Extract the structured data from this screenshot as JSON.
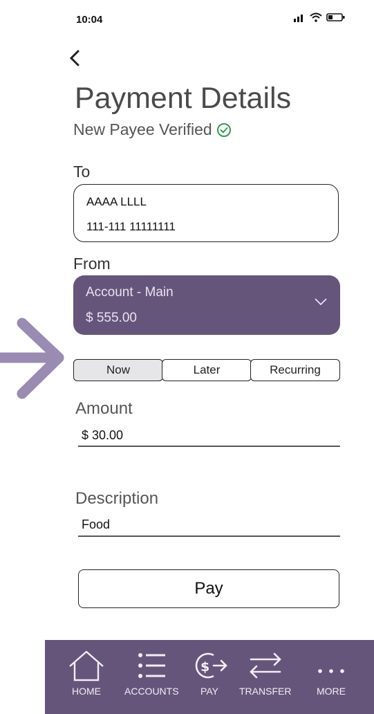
{
  "status": {
    "time": "10:04"
  },
  "header": {
    "title": "Payment Details",
    "verified_text": "New Payee Verified"
  },
  "to": {
    "label": "To",
    "name": "AAAA LLLL",
    "account": "111-111 11111111"
  },
  "from": {
    "label": "From",
    "account_name": "Account - Main",
    "balance": "$ 555.00"
  },
  "schedule": {
    "options": [
      "Now",
      "Later",
      "Recurring"
    ],
    "selected": "Now"
  },
  "amount": {
    "label": "Amount",
    "value": "$ 30.00"
  },
  "description": {
    "label": "Description",
    "value": "Food"
  },
  "pay_button": {
    "label": "Pay"
  },
  "bottom_nav": {
    "items": [
      {
        "label": "HOME",
        "icon": "home-icon"
      },
      {
        "label": "ACCOUNTS",
        "icon": "list-icon"
      },
      {
        "label": "PAY",
        "icon": "pay-icon"
      },
      {
        "label": "TRANSFER",
        "icon": "transfer-icon"
      },
      {
        "label": "MORE",
        "icon": "more-icon"
      }
    ]
  },
  "colors": {
    "accent": "#65557b",
    "arrow": "#9a8bb3",
    "verified": "#2e9e4a"
  }
}
